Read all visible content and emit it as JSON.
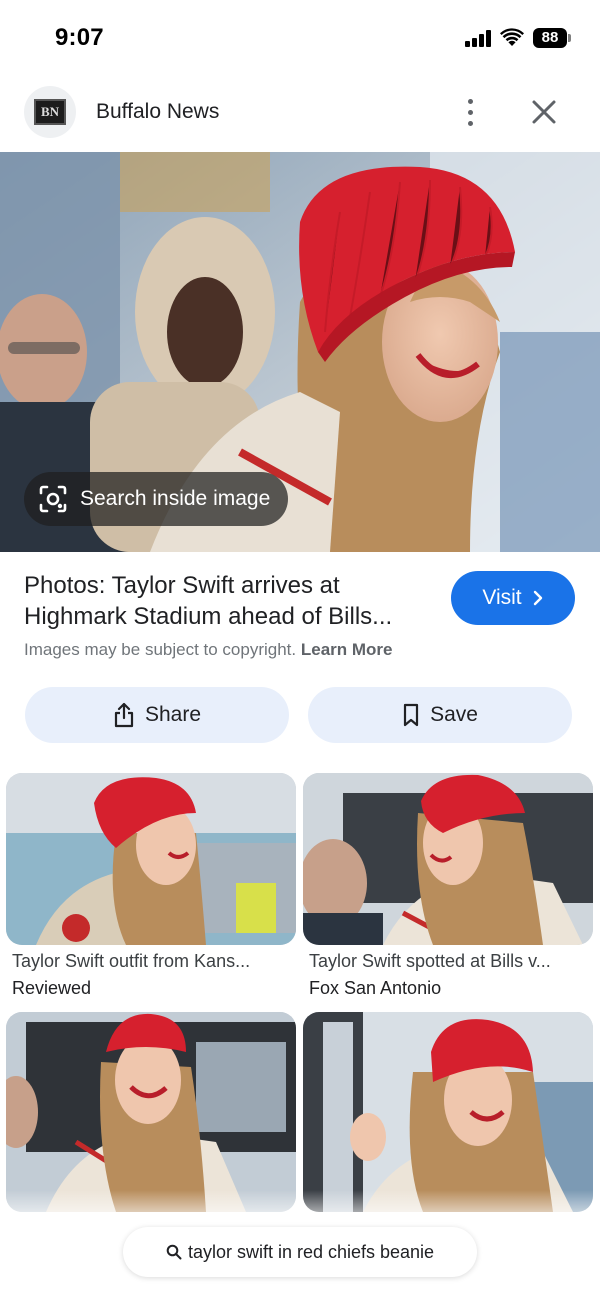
{
  "status_bar": {
    "time": "9:07",
    "battery": "88"
  },
  "header": {
    "site_name": "Buffalo News",
    "logo_text": "BN"
  },
  "hero": {
    "search_inside_label": "Search inside image"
  },
  "result": {
    "title_line1": "Photos: Taylor Swift arrives at",
    "title_line2": "Highmark Stadium ahead of Bills...",
    "visit_label": "Visit",
    "copyright_text": "Images may be subject to copyright.",
    "learn_more_label": "Learn More"
  },
  "actions": {
    "share_label": "Share",
    "save_label": "Save"
  },
  "related": [
    {
      "title": "Taylor Swift outfit from Kans...",
      "source": "Reviewed"
    },
    {
      "title": "Taylor Swift spotted at Bills v...",
      "source": "Fox San Antonio"
    },
    {
      "title": "",
      "source": ""
    },
    {
      "title": "",
      "source": ""
    }
  ],
  "query": {
    "text": "taylor swift in red chiefs beanie"
  },
  "colors": {
    "accent": "#1a73e8",
    "beanie_red": "#d6202e",
    "button_bg": "#e8effb"
  }
}
